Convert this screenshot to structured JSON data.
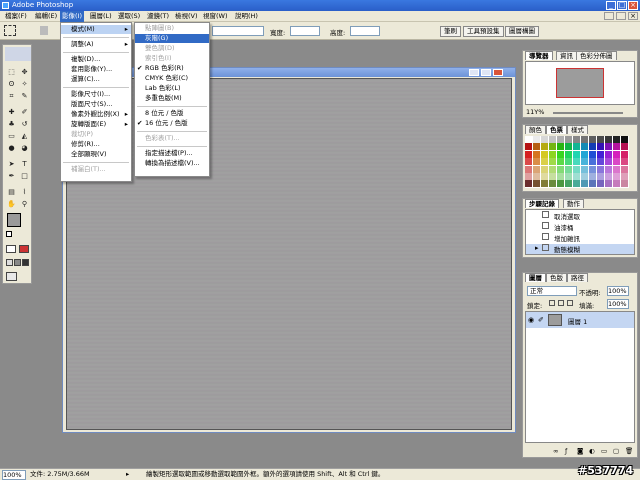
{
  "window": {
    "title": "Adobe Photoshop"
  },
  "menubar": {
    "items": [
      "檔案(F)",
      "編輯(E)",
      "影像(I)",
      "圖層(L)",
      "選取(S)",
      "濾鏡(T)",
      "檢視(V)",
      "視窗(W)",
      "說明(H)"
    ]
  },
  "optbar": {
    "width_label": "寬度:",
    "height_label": "高度:"
  },
  "palette_tabs": [
    "筆刷",
    "工具預設集",
    "圖層構圖"
  ],
  "image_menu": {
    "items": [
      {
        "label": "模式(M)",
        "submenu": true,
        "highlight": true
      },
      {
        "sep": true
      },
      {
        "label": "調整(A)",
        "submenu": true
      },
      {
        "sep": true
      },
      {
        "label": "複製(D)..."
      },
      {
        "label": "套用影像(Y)..."
      },
      {
        "label": "運算(C)..."
      },
      {
        "sep": true
      },
      {
        "label": "影像尺寸(I)..."
      },
      {
        "label": "版面尺寸(S)..."
      },
      {
        "label": "像素外觀比例(X)",
        "submenu": true
      },
      {
        "label": "旋轉版面(E)",
        "submenu": true
      },
      {
        "label": "裁切(P)",
        "disabled": true
      },
      {
        "label": "修剪(R)..."
      },
      {
        "label": "全部顯現(V)"
      },
      {
        "sep": true
      },
      {
        "label": "補漏白(T)...",
        "disabled": true
      }
    ]
  },
  "mode_menu": {
    "items": [
      {
        "label": "點陣圖(B)",
        "disabled": true
      },
      {
        "label": "灰階(G)",
        "highlight": true
      },
      {
        "label": "雙色調(D)",
        "disabled": true
      },
      {
        "label": "索引色(I)",
        "disabled": true
      },
      {
        "label": "RGB 色彩(R)",
        "checked": true
      },
      {
        "label": "CMYK 色彩(C)"
      },
      {
        "label": "Lab 色彩(L)"
      },
      {
        "label": "多重色版(M)"
      },
      {
        "sep": true
      },
      {
        "label": "8 位元 / 色版"
      },
      {
        "label": "16 位元 / 色版",
        "checked": true
      },
      {
        "sep": true
      },
      {
        "label": "色彩表(T)...",
        "disabled": true
      },
      {
        "sep": true
      },
      {
        "label": "指定描述檔(P)..."
      },
      {
        "label": "轉換為描述檔(V)..."
      }
    ]
  },
  "navigator": {
    "tabs": [
      "導覽器",
      "資訊",
      "色彩分佈圖"
    ],
    "zoom": "11Y%"
  },
  "swatches": {
    "tabs": [
      "顏色",
      "色票",
      "樣式"
    ]
  },
  "history": {
    "tabs": [
      "步驟記錄",
      "動作"
    ],
    "items": [
      "取消選取",
      "油漆桶",
      "增加雜訊",
      "動態模糊"
    ]
  },
  "layers": {
    "tabs": [
      "圖層",
      "色版",
      "路徑"
    ],
    "blend_mode": "正常",
    "opacity_label": "不透明:",
    "opacity_value": "100%",
    "lock_label": "鎖定:",
    "fill_label": "填滿:",
    "fill_value": "100%",
    "layer_name": "圖層 1"
  },
  "statusbar": {
    "zoom": "100%",
    "doc_info": "文件: 2.75M/3.66M",
    "hint": "繪製矩形選取範圍或移動選取範圍外框。額外的選項請使用 Shift、Alt 和 Ctrl 鍵。"
  },
  "watermark": "#537774"
}
